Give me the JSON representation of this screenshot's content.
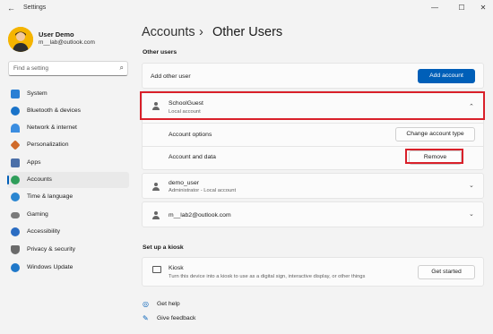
{
  "window": {
    "title": "Settings",
    "back": "←",
    "minimize": "—",
    "maximize": "☐",
    "close": "✕"
  },
  "profile": {
    "name": "User Demo",
    "email": "m__lab@outlook.com"
  },
  "search": {
    "placeholder": "Find a setting",
    "icon": "⌕"
  },
  "nav": [
    {
      "label": "System",
      "color": "#2a7fd4"
    },
    {
      "label": "Bluetooth & devices",
      "color": "#1a73c9"
    },
    {
      "label": "Network & internet",
      "color": "#3b8de0"
    },
    {
      "label": "Personalization",
      "color": "#d06a2a"
    },
    {
      "label": "Apps",
      "color": "#4b6fa8"
    },
    {
      "label": "Accounts",
      "color": "#2f9e5a"
    },
    {
      "label": "Time & language",
      "color": "#2a86d1"
    },
    {
      "label": "Gaming",
      "color": "#7a7a7a"
    },
    {
      "label": "Accessibility",
      "color": "#2a6cc2"
    },
    {
      "label": "Privacy & security",
      "color": "#6a6a6a"
    },
    {
      "label": "Windows Update",
      "color": "#1f78c9"
    }
  ],
  "breadcrumb": {
    "parent": "Accounts",
    "sep": "›",
    "current": "Other Users"
  },
  "other_users": {
    "heading": "Other users",
    "add_label": "Add other user",
    "add_button": "Add account",
    "expanded_user": {
      "name": "SchoolGuest",
      "type": "Local account",
      "options_label": "Account options",
      "options_button": "Change account type",
      "data_label": "Account and data",
      "data_button": "Remove"
    },
    "users": [
      {
        "name": "demo_user",
        "type": "Administrator - Local account"
      },
      {
        "name": "m__lab2@outlook.com",
        "type": ""
      }
    ]
  },
  "kiosk": {
    "heading": "Set up a kiosk",
    "title": "Kiosk",
    "desc": "Turn this device into a kiosk to use as a digital sign, interactive display, or other things",
    "button": "Get started"
  },
  "links": {
    "help": "Get help",
    "feedback": "Give feedback"
  }
}
